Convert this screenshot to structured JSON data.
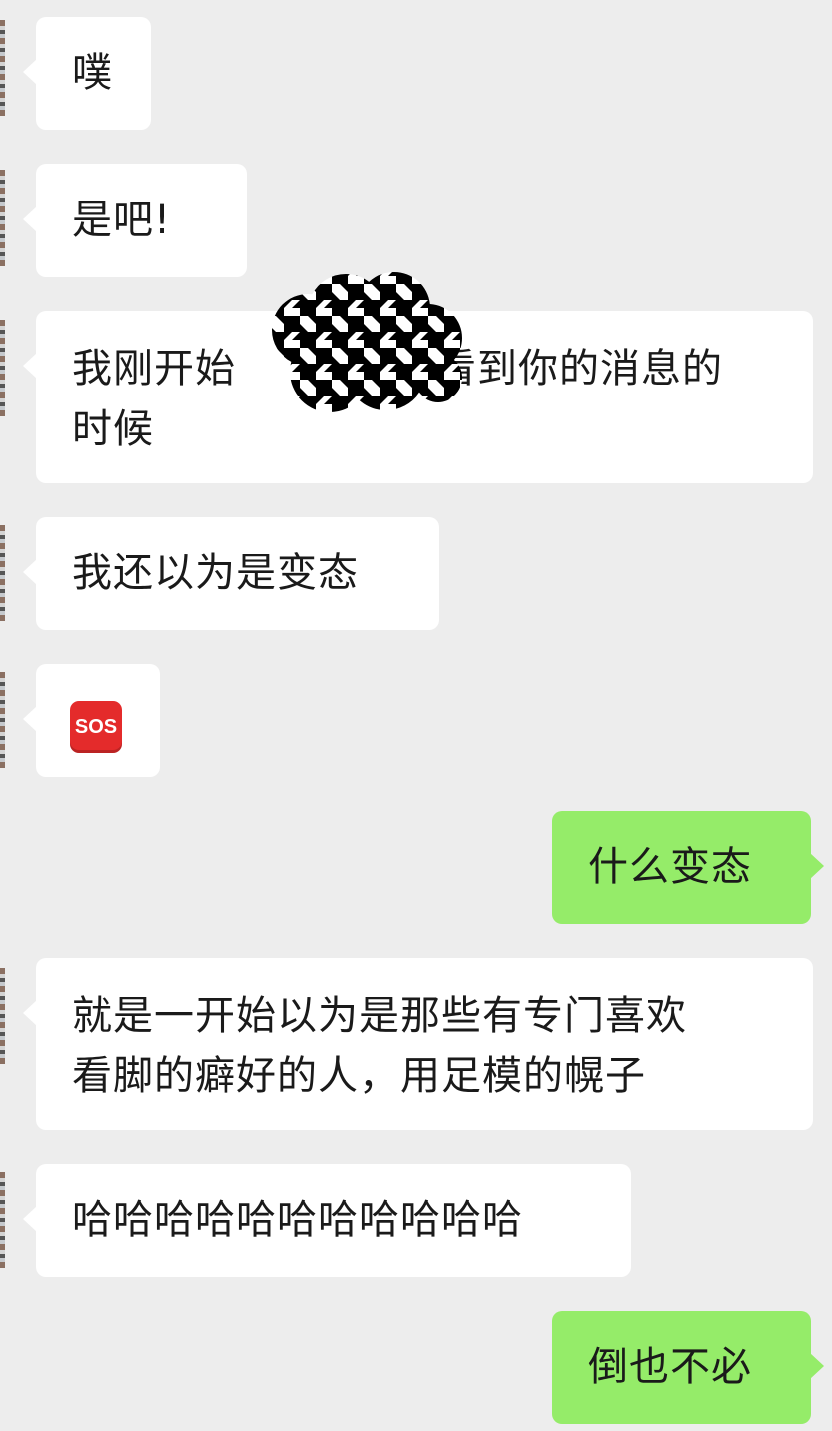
{
  "messages": [
    {
      "side": "left",
      "text": "噗"
    },
    {
      "side": "left",
      "text": "是吧!"
    },
    {
      "side": "left",
      "text_line1": "我刚开始",
      "text_line1_after": "看到你的消息的",
      "text_line2": "时候"
    },
    {
      "side": "left",
      "text": "我还以为是变态"
    },
    {
      "side": "left",
      "emoji": "sos-emoji",
      "emoji_text": "SOS"
    },
    {
      "side": "right",
      "text": "什么变态"
    },
    {
      "side": "left",
      "text_line1": "就是一开始以为是那些有专门喜欢",
      "text_line2": "看脚的癖好的人，用足模的幌子"
    },
    {
      "side": "left",
      "text": "哈哈哈哈哈哈哈哈哈哈哈"
    },
    {
      "side": "right",
      "text": "倒也不必"
    }
  ],
  "colors": {
    "background": "#ededed",
    "incoming_bubble": "#ffffff",
    "outgoing_bubble": "#95ec69",
    "text": "#1a1a1a",
    "sos": "#e42b2b"
  },
  "censor_overlay": "houndstooth-censor-pattern"
}
